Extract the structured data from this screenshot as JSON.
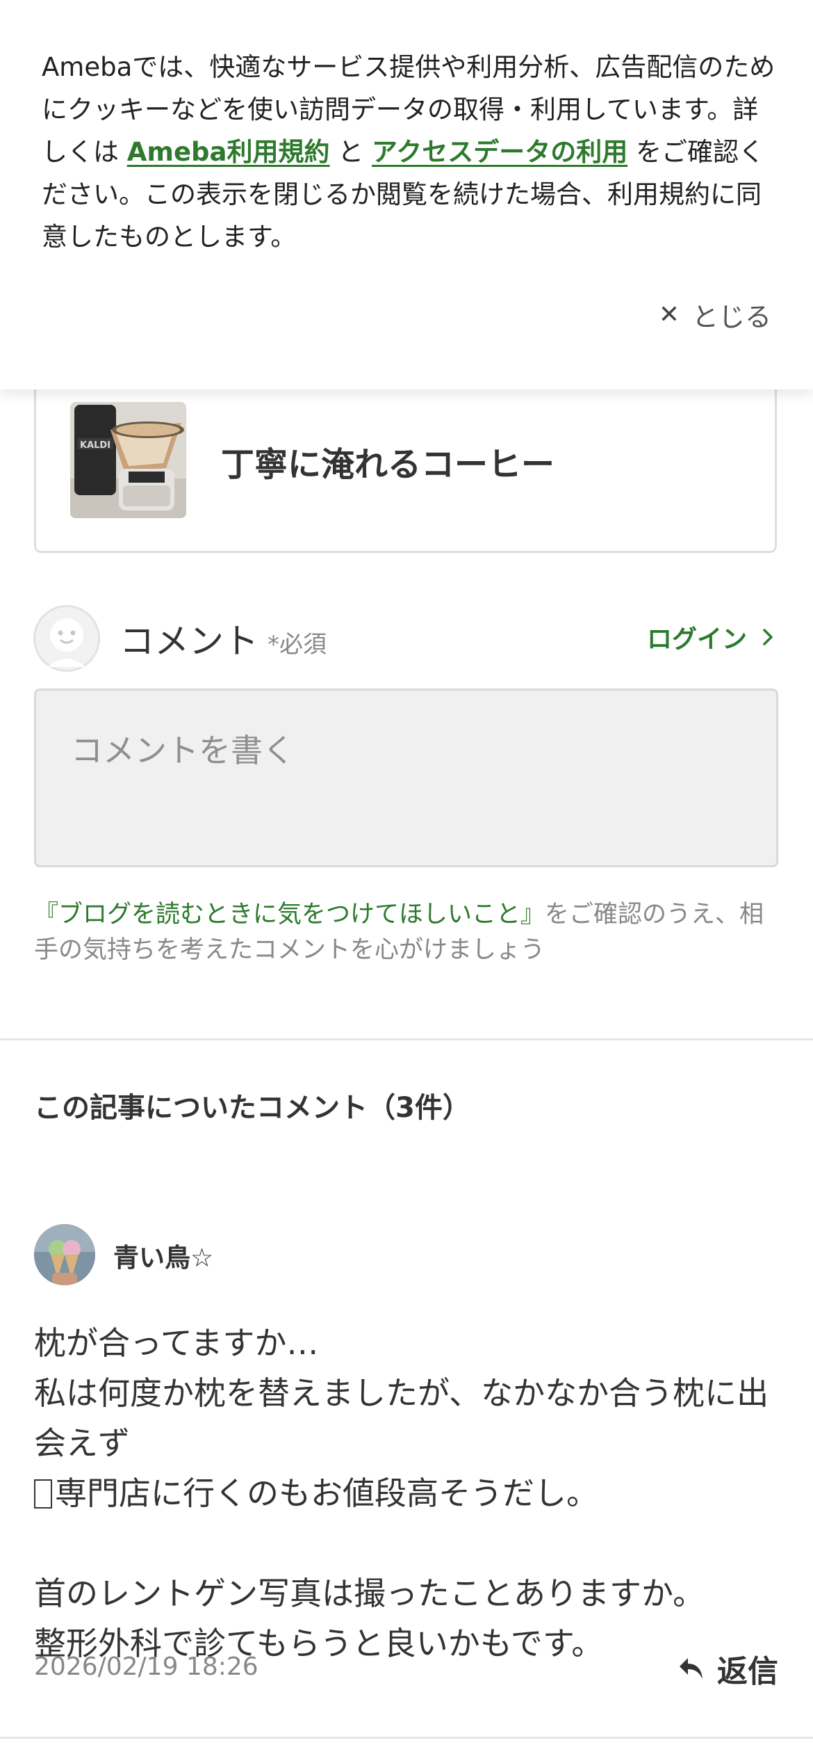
{
  "cookie_banner": {
    "text_before_link1": "Amebaでは、快適なサービス提供や利用分析、広告配信のためにクッキーなどを使い訪問データの取得・利用しています。詳しくは ",
    "link1": "Ameba利用規約",
    "text_between": " と ",
    "link2": "アクセスデータの利用",
    "text_after": " をご確認ください。この表示を閉じるか閲覧を続けた場合、利用規約に同意したものとします。",
    "close_icon": "close-x",
    "close_label": "とじる"
  },
  "article_card": {
    "title": "丁寧に淹れるコーヒー"
  },
  "comment_form": {
    "heading": "コメント",
    "required": "*必須",
    "login_label": "ログイン",
    "textarea_placeholder": "コメントを書く",
    "guideline_link": "『ブログを読むときに気をつけてほしいこと』",
    "guideline_text": "をご確認のうえ、相手の気持ちを考えたコメントを心がけましょう"
  },
  "comments_section": {
    "heading": "この記事についたコメント（3件）",
    "items": [
      {
        "author": "青い鳥☆",
        "body_lines": [
          "枕が合ってますか…",
          "私は何度か枕を替えましたが、なかなか合う枕に出会えず",
          "専門店に行くのもお値段高そうだし。",
          "首のレントゲン写真は撮ったことありますか。",
          "整形外科で診てもらうと良いかもです。"
        ],
        "date": "2026/02/19 18:26",
        "reply_label": "返信"
      }
    ]
  },
  "colors": {
    "accent_green": "#2d7a2d",
    "text_primary": "#333333",
    "text_muted": "#888888"
  }
}
